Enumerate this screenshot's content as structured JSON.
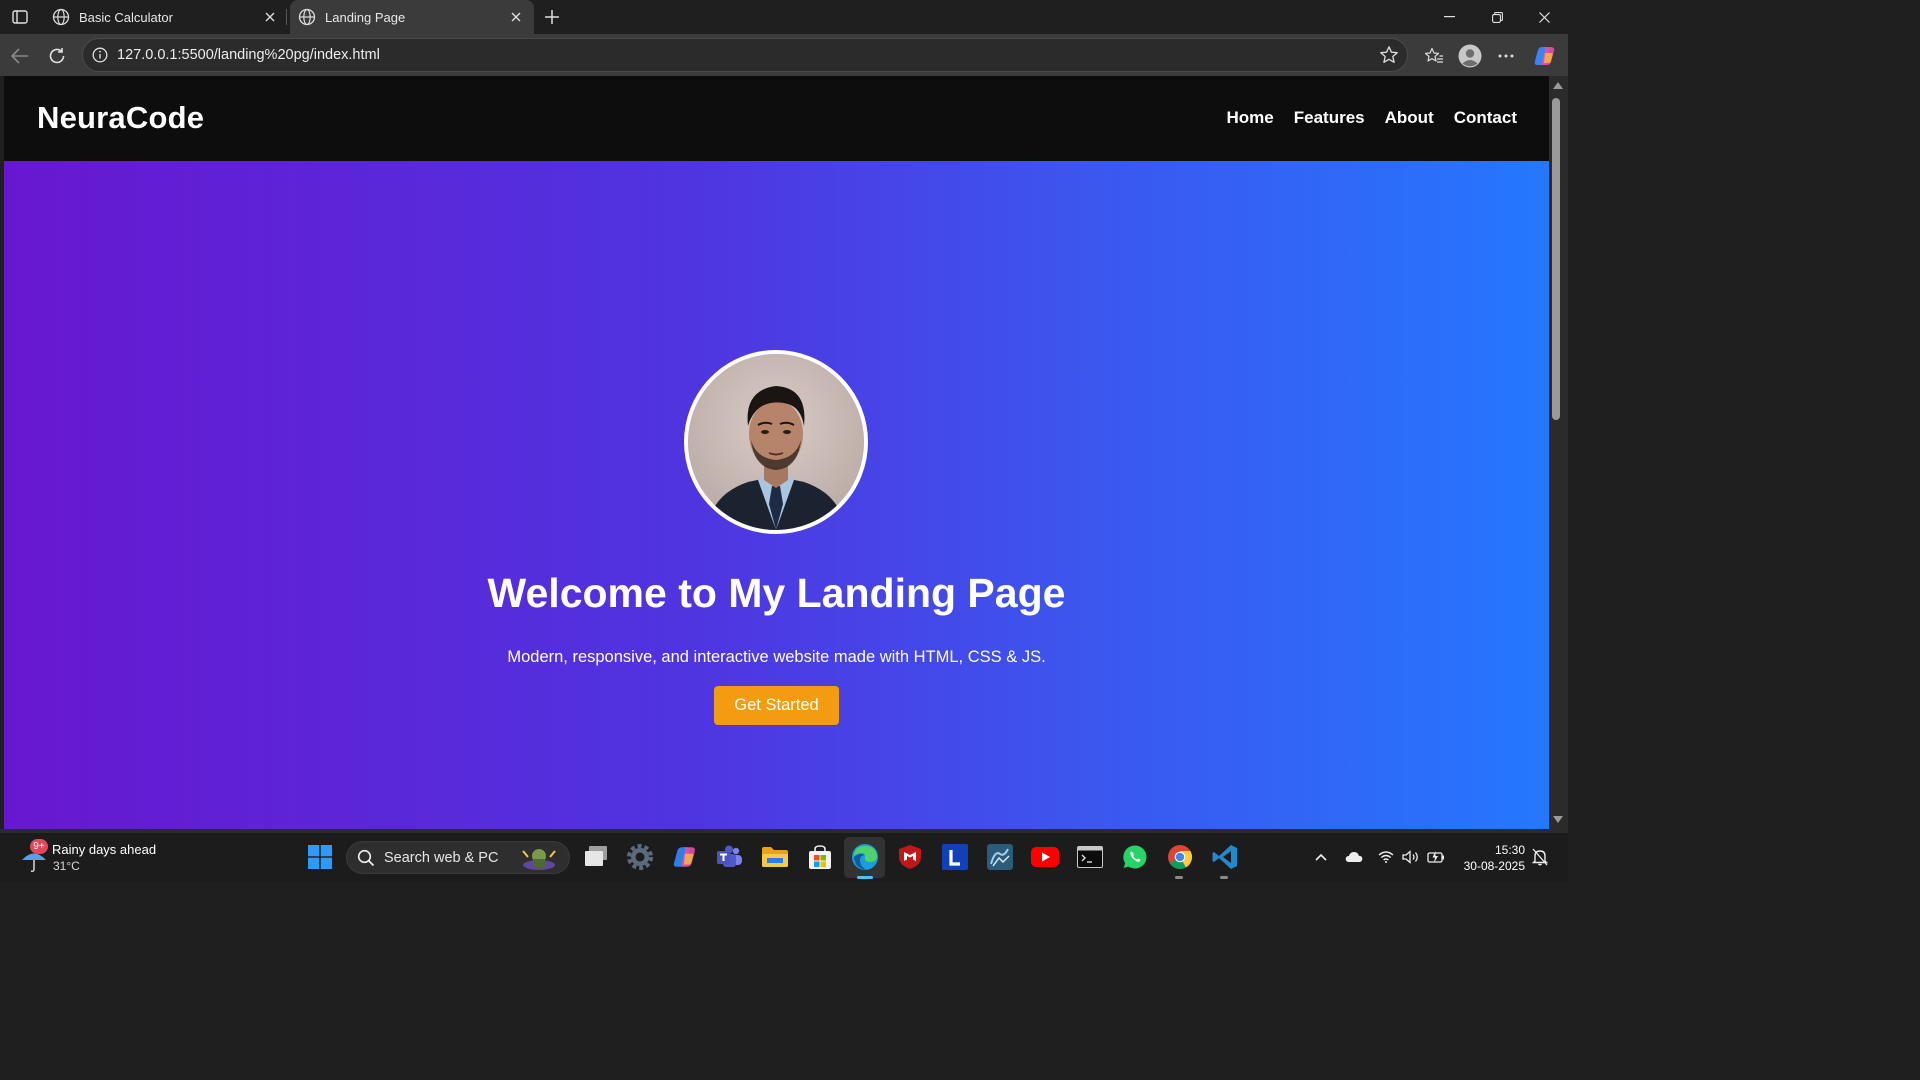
{
  "browser": {
    "tabs": [
      {
        "title": "Basic Calculator",
        "active": false
      },
      {
        "title": "Landing Page",
        "active": true
      }
    ],
    "url": "127.0.0.1:5500/landing%20pg/index.html"
  },
  "site": {
    "logo": "NeuraCode",
    "nav": [
      "Home",
      "Features",
      "About",
      "Contact"
    ],
    "hero": {
      "title": "Welcome to My Landing Page",
      "subtitle": "Modern, responsive, and interactive website made with HTML, CSS & JS.",
      "cta": "Get Started"
    },
    "colors": {
      "nav_bg": "#0d0d0d",
      "gradient_start": "#6817d0",
      "gradient_end": "#2577ff",
      "cta_bg": "#f39c12"
    }
  },
  "taskbar": {
    "weather": {
      "text": "Rainy days ahead",
      "temp": "31°C",
      "badge": "9+"
    },
    "search_placeholder": "Search web & PC",
    "apps": [
      "windows-start",
      "search",
      "task-view",
      "settings",
      "copilot",
      "teams",
      "file-explorer",
      "microsoft-store",
      "edge",
      "mcafee",
      "l-app",
      "mysql-workbench",
      "youtube",
      "terminal",
      "whatsapp",
      "chrome",
      "vscode"
    ],
    "time": "15:30",
    "date": "30-08-2025"
  }
}
